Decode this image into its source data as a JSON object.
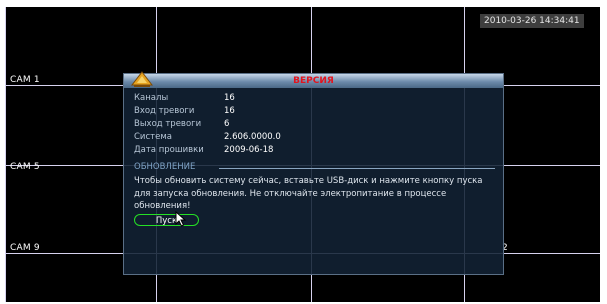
{
  "screen": {
    "timestamp": "2010-03-26 14:34:41",
    "cameras": [
      "CAM 1",
      "CAM 5",
      "CAM 9"
    ],
    "partial_label": "2"
  },
  "dialog": {
    "title": "ВЕРСИЯ",
    "logo_icon": "app-logo-icon",
    "info": [
      {
        "label": "Каналы",
        "value": "16"
      },
      {
        "label": "Вход тревоги",
        "value": "16"
      },
      {
        "label": "Выход тревоги",
        "value": "6"
      },
      {
        "label": "Система",
        "value": "2.606.0000.0"
      },
      {
        "label": "Дата прошивки",
        "value": "2009-06-18"
      }
    ],
    "section_title": "ОБНОВЛЕНИЕ",
    "message": "Чтобы обновить систему сейчас, вставьте USB-диск и нажмите кнопку пуска для запуска обновления. Не отключайте электропитание в процессе обновления!",
    "start_label": "Пуск"
  },
  "colors": {
    "grid_line": "#d6d2ee",
    "title_text": "#e3141e",
    "button_border": "#25e025"
  }
}
